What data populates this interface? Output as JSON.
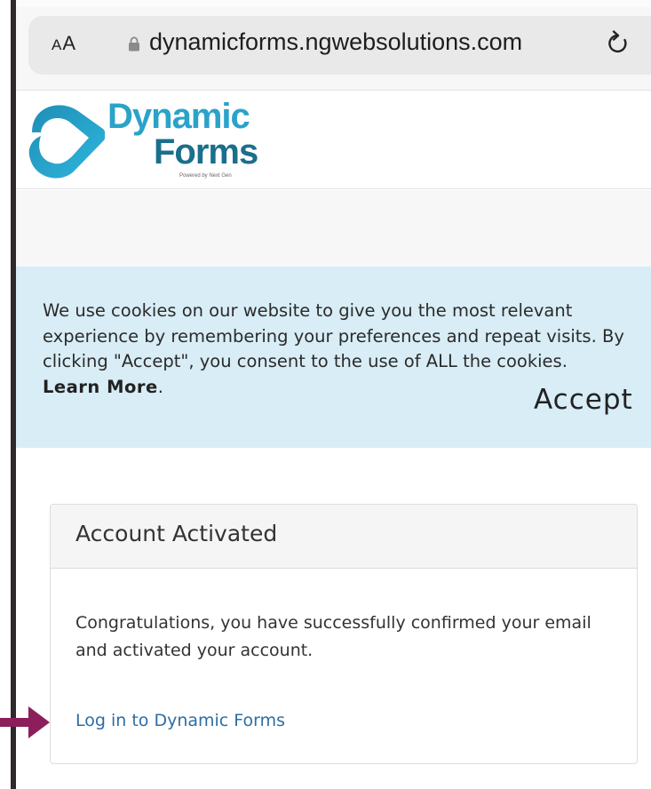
{
  "browser": {
    "aa_small": "A",
    "aa_large": "A",
    "url": "dynamicforms.ngwebsolutions.com",
    "icons": {
      "lock": "lock-icon",
      "reload": "reload-icon"
    }
  },
  "logo": {
    "word1": "Dynamic",
    "word2": "Forms",
    "tagline": "Powered by Next Gen",
    "colors": {
      "light": "#2aa3c9",
      "dark": "#1a6f8c"
    }
  },
  "cookie_banner": {
    "text": "We use cookies on our website to give you the most relevant experience by remembering your preferences and repeat visits. By clicking \"Accept\", you consent to the use of ALL the cookies.",
    "learn_more": "Learn More",
    "learn_more_suffix": ".",
    "accept_label": "Accept",
    "background": "#d8edf6"
  },
  "card": {
    "title": "Account Activated",
    "message": "Congratulations, you have successfully confirmed your email and activated your account.",
    "login_link": "Log in to Dynamic Forms",
    "link_color": "#2e6da4"
  },
  "annotation": {
    "arrow_color": "#8b1e5b"
  }
}
